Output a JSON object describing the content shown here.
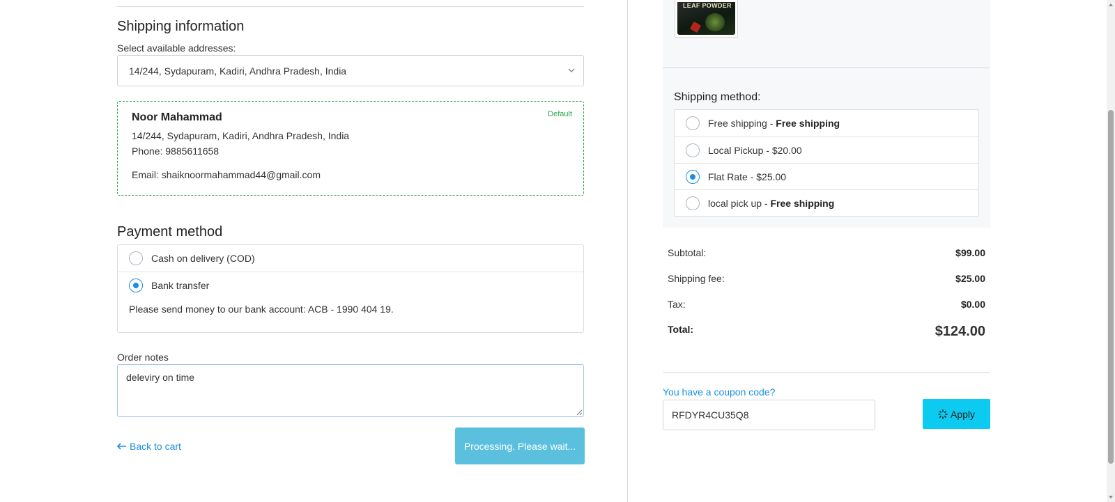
{
  "shipping_info": {
    "title": "Shipping information",
    "select_label": "Select available addresses:",
    "selected_address": "14/244, Sydapuram, Kadiri, Andhra Pradesh, India",
    "card": {
      "name": "Noor Mahammad",
      "address": "14/244, Sydapuram, Kadiri, Andhra Pradesh, India",
      "phone": "Phone: 9885611658",
      "email": "Email: shaiknoormahammad44@gmail.com",
      "badge": "Default"
    }
  },
  "payment": {
    "title": "Payment method",
    "options": [
      {
        "label": "Cash on delivery (COD)",
        "selected": false
      },
      {
        "label": "Bank transfer",
        "selected": true
      }
    ],
    "bank_note": "Please send money to our bank account: ACB - 1990 404 19."
  },
  "order_notes": {
    "label": "Order notes",
    "value": "deleviry on time"
  },
  "actions": {
    "back_label": "Back to cart",
    "submit_label": "Processing. Please wait..."
  },
  "product_thumb": {
    "visible_text": "LEAF POWDER"
  },
  "shipping_method": {
    "title": "Shipping method:",
    "options": [
      {
        "name": "Free shipping",
        "price": "Free shipping",
        "selected": false
      },
      {
        "name": "Local Pickup",
        "price": "$20.00",
        "selected": false
      },
      {
        "name": "Flat Rate",
        "price": "$25.00",
        "selected": true
      },
      {
        "name": "local pick up",
        "price": "Free shipping",
        "selected": false
      }
    ]
  },
  "summary": {
    "subtotal_label": "Subtotal:",
    "subtotal": "$99.00",
    "shipping_label": "Shipping fee:",
    "shipping": "$25.00",
    "tax_label": "Tax:",
    "tax": "$0.00",
    "total_label": "Total:",
    "total": "$124.00"
  },
  "coupon": {
    "link": "You have a coupon code?",
    "value": "RFDYR4CU35Q8",
    "apply_label": "Apply"
  },
  "colors": {
    "link": "#1a8fe3",
    "default_badge": "#2ea44f",
    "processing_button": "#5bc0de",
    "apply_button": "#0dcaf0"
  }
}
